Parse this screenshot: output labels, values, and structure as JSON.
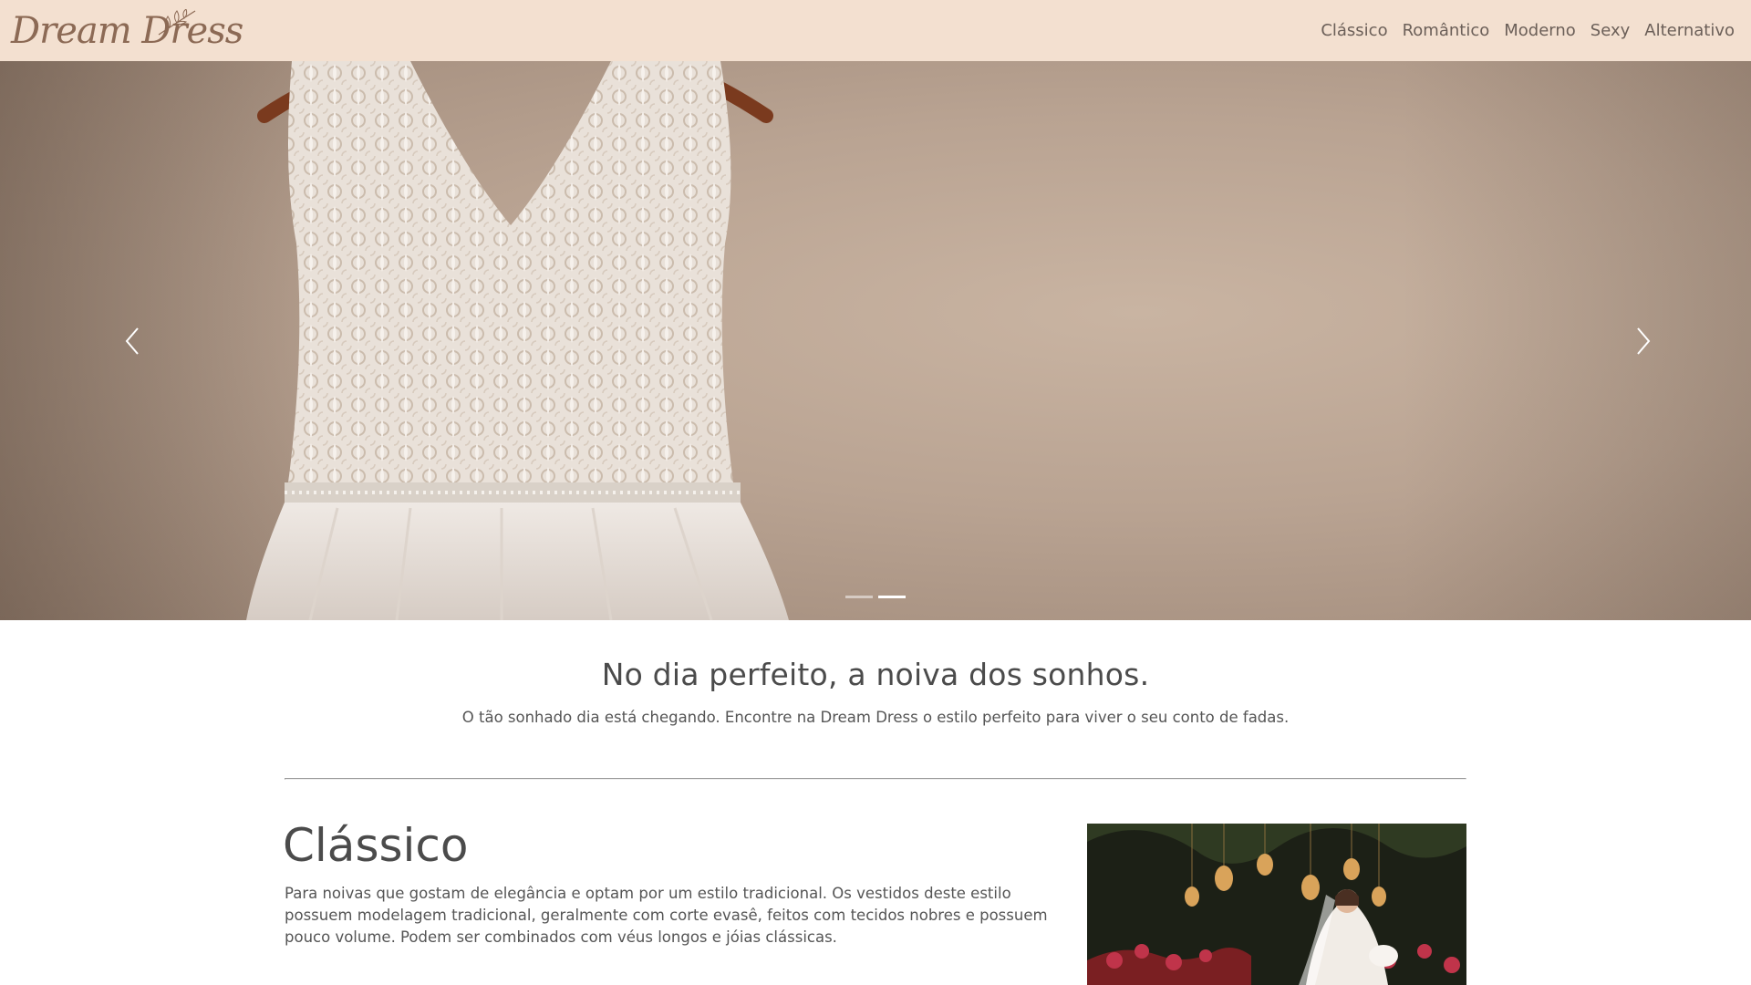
{
  "brand": {
    "name": "Dream Dress"
  },
  "nav": {
    "items": [
      {
        "label": "Clássico"
      },
      {
        "label": "Romântico"
      },
      {
        "label": "Moderno"
      },
      {
        "label": "Sexy"
      },
      {
        "label": "Alternativo"
      }
    ]
  },
  "carousel": {
    "slides": 2,
    "active_slide": 2,
    "prev_icon": "chevron-left-icon",
    "next_icon": "chevron-right-icon"
  },
  "intro": {
    "title": "No dia perfeito, a noiva dos sonhos.",
    "text": "O tão sonhado dia está chegando. Encontre na Dream Dress o estilo perfeito para viver o seu conto de fadas."
  },
  "section": {
    "title": "Clássico",
    "text": "Para noivas que gostam de elegância e optam por um estilo tradicional. Os vestidos deste estilo possuem modelagem tradicional, geralmente com corte evasê, feitos com tecidos nobres e possuem pouco volume. Podem ser combinados com véus longos e jóias clássicas."
  },
  "colors": {
    "navbar_bg": "#f3e0d0",
    "brand": "#8c6a55",
    "text": "#4b4b4b"
  }
}
